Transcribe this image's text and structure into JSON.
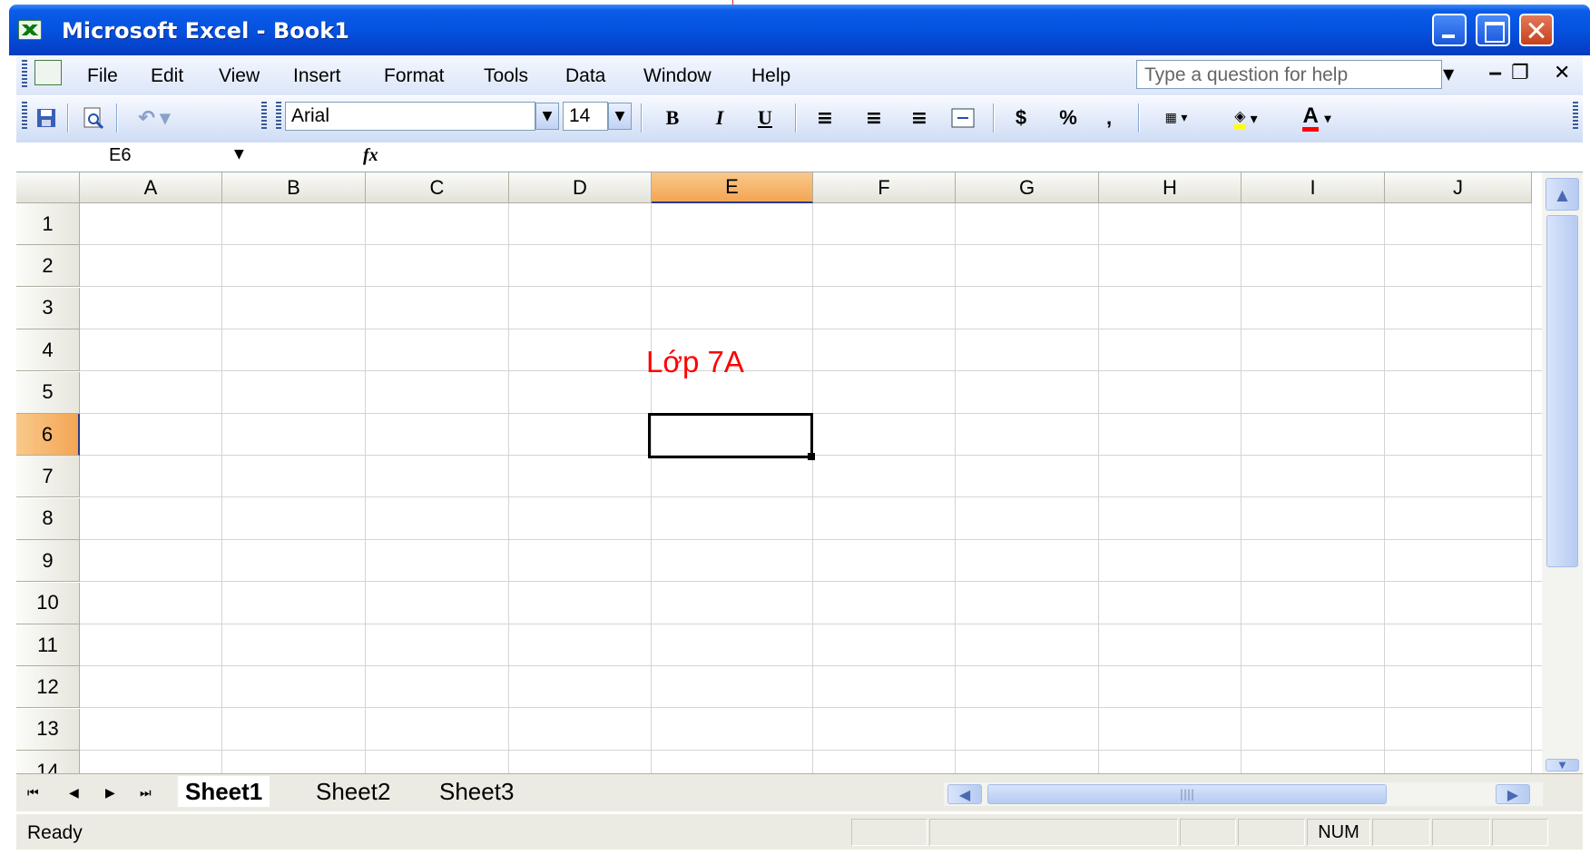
{
  "window": {
    "title": "Microsoft Excel - Book1"
  },
  "menu": {
    "items": [
      "File",
      "Edit",
      "View",
      "Insert",
      "Format",
      "Tools",
      "Data",
      "Window",
      "Help"
    ],
    "help_placeholder": "Type a question for help"
  },
  "toolbar": {
    "font": "Arial",
    "size": "14",
    "bold": "B",
    "italic": "I",
    "underline": "U",
    "currency": "$",
    "percent": "%",
    "comma": ","
  },
  "formula": {
    "namebox": "E6",
    "fx": "fx"
  },
  "grid": {
    "columns": [
      "A",
      "B",
      "C",
      "D",
      "E",
      "F",
      "G",
      "H",
      "I",
      "J"
    ],
    "rows": [
      "1",
      "2",
      "3",
      "4",
      "5",
      "6",
      "7",
      "8",
      "9",
      "10",
      "11",
      "12",
      "13",
      "14"
    ],
    "active_col": "E",
    "active_row": "6",
    "cell_E5": "Lớp 7A",
    "text_color": "#ff0000"
  },
  "sheets": {
    "tabs": [
      "Sheet1",
      "Sheet2",
      "Sheet3"
    ],
    "active": "Sheet1"
  },
  "status": {
    "text": "Ready",
    "num": "NUM"
  },
  "colors": {
    "titlebar": "#0552e0",
    "header_active": "#f3a554",
    "toolbar": "#c3d6f5"
  }
}
